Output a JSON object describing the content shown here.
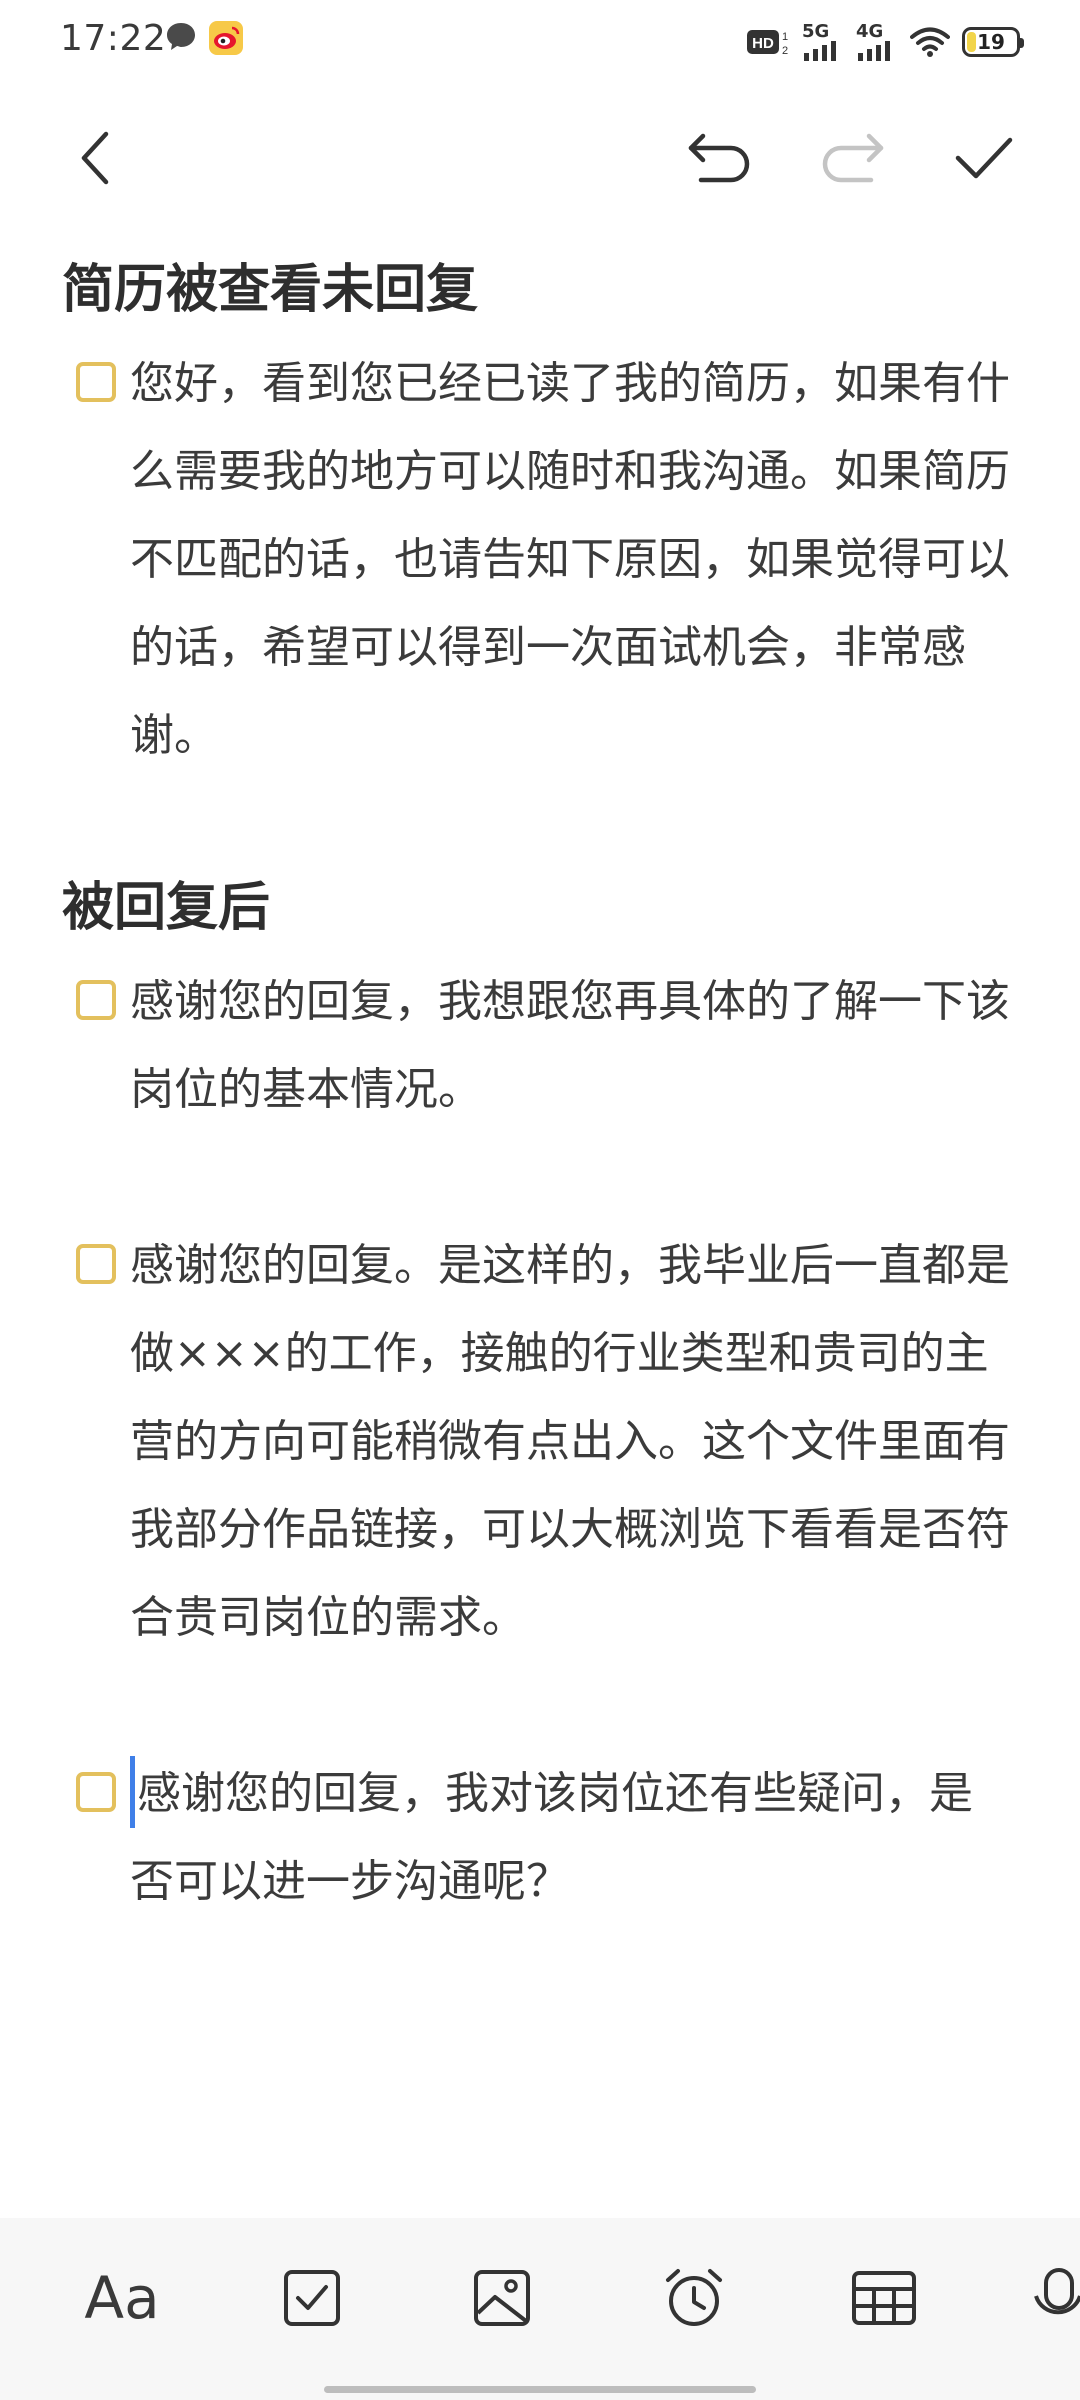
{
  "status_bar": {
    "time": "17:22",
    "network_1": "5G",
    "network_2": "4G",
    "hd_label": "HD",
    "battery_level": "19",
    "battery_fraction": 0.19
  },
  "toolbar": {
    "back_icon": "chevron-left-icon",
    "undo_icon": "undo-icon",
    "redo_icon": "redo-icon",
    "done_icon": "check-icon"
  },
  "sections": [
    {
      "title": "简历被查看未回复",
      "tasks": [
        {
          "text": "您好，看到您已经已读了我的简历，如果有什么需要我的地方可以随时和我沟通。如果简历不匹配的话，也请告知下原因，如果觉得可以的话，希望可以得到一次面试机会，非常感谢。",
          "checked": false
        }
      ]
    },
    {
      "title": "被回复后",
      "tasks": [
        {
          "text": "感谢您的回复，我想跟您再具体的了解一下该岗位的基本情况。",
          "checked": false
        },
        {
          "text": "感谢您的回复。是这样的，我毕业后一直都是做×××的工作，接触的行业类型和贵司的主营的方向可能稍微有点出入。这个文件里面有我部分作品链接，可以大概浏览下看看是否符合贵司岗位的需求。",
          "checked": false
        },
        {
          "text": "感谢您的回复，我对该岗位还有些疑问，是否可以进一步沟通呢？",
          "checked": false
        }
      ]
    }
  ],
  "bottom_bar": {
    "text_style_label": "Aa",
    "items": [
      "text-style-icon",
      "checklist-icon",
      "image-icon",
      "alarm-icon",
      "table-icon",
      "mic-icon"
    ]
  }
}
